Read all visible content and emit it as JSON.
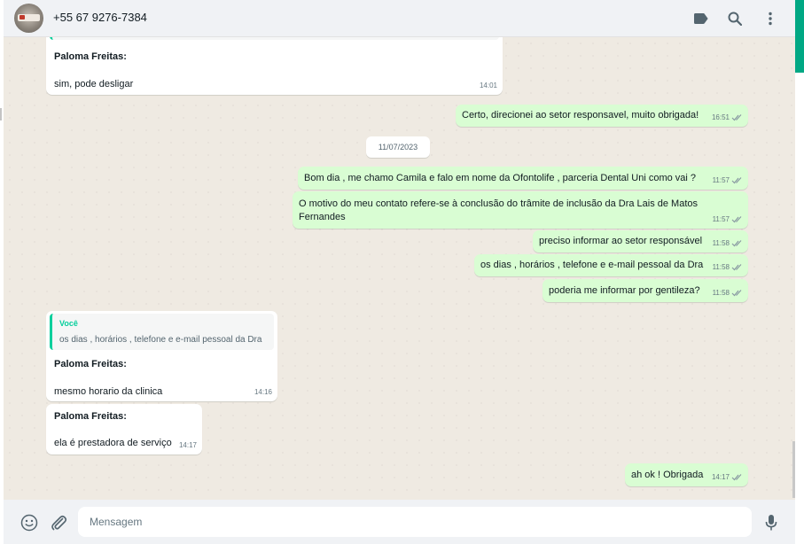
{
  "header": {
    "contact": "+55 67 9276-7384",
    "icons": [
      "label-icon",
      "search-icon",
      "menu-icon"
    ]
  },
  "chat": {
    "date_separator": "11/07/2023",
    "messages": [
      {
        "id": "m1",
        "dir": "in",
        "sender": "Paloma Freitas:",
        "text": "sim, pode desligar",
        "time": "14:01"
      },
      {
        "id": "m2",
        "dir": "out",
        "text": "Certo, direcionei ao setor responsavel, muito obrigada!",
        "time": "16:51"
      },
      {
        "id": "m3",
        "dir": "out",
        "text": "Bom dia , me chamo Camila e falo em nome da Ofontolife , parceria Dental Uni como vai ?",
        "time": "11:57"
      },
      {
        "id": "m4",
        "dir": "out",
        "text": "O motivo do meu contato refere-se à conclusão do trâmite de inclusão da Dra Lais de Matos Fernandes",
        "time": "11:57"
      },
      {
        "id": "m5",
        "dir": "out",
        "text": "preciso informar ao setor responsável",
        "time": "11:58"
      },
      {
        "id": "m6",
        "dir": "out",
        "text": "os dias , horários , telefone e e-mail pessoal da Dra",
        "time": "11:58"
      },
      {
        "id": "m7",
        "dir": "out",
        "text": "poderia me informar por gentileza?",
        "time": "11:58"
      },
      {
        "id": "m8",
        "dir": "in",
        "quote_author": "Você",
        "quote_text": "os dias , horários , telefone e e-mail pessoal da Dra",
        "sender": "Paloma Freitas:",
        "text": "mesmo horario da clinica",
        "time": "14:16"
      },
      {
        "id": "m9",
        "dir": "in",
        "sender": "Paloma Freitas:",
        "text": "ela é prestadora de serviço",
        "time": "14:17"
      },
      {
        "id": "m10",
        "dir": "out",
        "text": "ah ok ! Obrigada",
        "time": "14:17"
      }
    ]
  },
  "footer": {
    "placeholder": "Mensagem",
    "icons": [
      "emoji-icon",
      "attach-icon",
      "mic-icon"
    ]
  },
  "colors": {
    "outgoing": "#d9fdd3",
    "incoming": "#ffffff",
    "background": "#efeae2",
    "accent": "#00a884",
    "read_ticks": "#8696a0"
  }
}
